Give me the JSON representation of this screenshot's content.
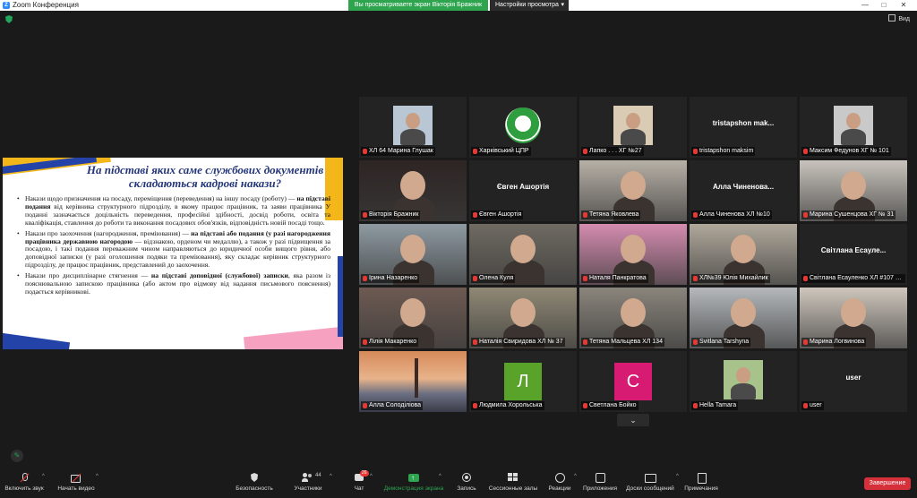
{
  "window": {
    "title": "Zoom Конференция",
    "share_banner": "Вы просматриваете экран Вікторія Бражник",
    "view_settings": "Настройки просмотра",
    "min": "—",
    "max": "□",
    "close": "✕"
  },
  "topbar": {
    "view_label": "Вид"
  },
  "slide": {
    "title": "На підставі яких саме службових документів складаються кадрові накази?",
    "paragraphs": [
      {
        "a": "Накази щодо призначення на посаду, переміщення (переведення) на іншу посаду (роботу) — ",
        "b": "на підставі подання",
        "c": " від керівника структурного підрозділу, в якому працює працівник, та заяви працівника У поданні зазначається доцільність переведення, професійні здібності, досвід роботи, освіта та кваліфікація, ставлення до роботи та виконання посадових обов'язків, відповідність новій посаді тощо."
      },
      {
        "a": "Накази про заохочення (нагородження, преміювання) — ",
        "b": "на підставі або подання (у разі нагородження працівника державною нагородою",
        "c": " — відзнакою, орденом чи медаллю), а також у разі підвищення за посадою, і такі подання переважним чином направляються до юридичної особи вищого рівня, або доповідної записки (у разі оголошення подяки та преміювання), яку складає керівник структурного підрозділу, де працює працівник, представлений до заохочення."
      },
      {
        "a": "Накази про дисциплінарне стягнення — ",
        "b": "на підставі доповідної (службової) записки",
        "c": ", яка разом із пояснювальною запискою працівника (або актом про відмову від надання письмового пояснення) подається керівникові."
      }
    ]
  },
  "participants": [
    {
      "name": "ХЛ 64 Марина Глушак",
      "kind": "photo-small",
      "color": "#b9c6d4"
    },
    {
      "name": "Харківський ЦПР",
      "kind": "logo"
    },
    {
      "name": "Лапко . . . ХГ №27",
      "kind": "photo-small",
      "color": "#d9cbb4"
    },
    {
      "name": "tristapshon maksim",
      "kind": "text",
      "big": "tristapshon mak..."
    },
    {
      "name": "Максим Федунов ХГ № 101",
      "kind": "photo-small",
      "color": "#c9c9c9"
    },
    {
      "name": "Вікторія Бражник",
      "kind": "video",
      "color": "#2e2524",
      "active": true
    },
    {
      "name": "Євген Ашортія",
      "kind": "text",
      "big": "Євген Ашортія"
    },
    {
      "name": "Тетяна Яковлева",
      "kind": "video",
      "color": "#b7b0a6"
    },
    {
      "name": "Алла Чиненова ХЛ №10",
      "kind": "text",
      "big": "Алла Чиненова..."
    },
    {
      "name": "Марина Сушенцова ХГ № 31",
      "kind": "video",
      "color": "#c8c3bc"
    },
    {
      "name": "Ірина Назаренко",
      "kind": "video",
      "color": "#8e9aa2"
    },
    {
      "name": "Олена Куля",
      "kind": "video",
      "color": "#6f6a62"
    },
    {
      "name": "Наталя Панкратова",
      "kind": "video",
      "color": "#d58cb0"
    },
    {
      "name": "ХЛ№39 Юлія Михайлик",
      "kind": "video",
      "color": "#b0a89b"
    },
    {
      "name": "Світлана Есауленко ХЛ #107 Х...",
      "kind": "text",
      "big": "Світлана Есауле..."
    },
    {
      "name": "Лілія Макаренко",
      "kind": "video",
      "color": "#6d5a52"
    },
    {
      "name": "Наталія Свиридова ХЛ № 37",
      "kind": "video",
      "color": "#8f8875"
    },
    {
      "name": "Тетяна Мальцева ХЛ 134",
      "kind": "video",
      "color": "#8a857c"
    },
    {
      "name": "Svitlana Tarshyna",
      "kind": "video",
      "color": "#b5b9bc"
    },
    {
      "name": "Марина Логвинова",
      "kind": "video",
      "color": "#cfc7bd"
    },
    {
      "name": "Алла Солоділіова",
      "kind": "bridge"
    },
    {
      "name": "Людмила Хорольська",
      "kind": "letter",
      "letter": "Л",
      "color": "#5aa32b"
    },
    {
      "name": "Светлана Бойко",
      "kind": "letter",
      "letter": "С",
      "color": "#d81b72"
    },
    {
      "name": "Hella Tamara",
      "kind": "photo-small",
      "color": "#a7c28a"
    },
    {
      "name": "user",
      "kind": "text",
      "big": "user"
    }
  ],
  "toolbar": {
    "mute_label": "Включить звук",
    "video_label": "Начать видео",
    "security_label": "Безопасность",
    "participants_label": "Участники",
    "participants_count": "44",
    "chat_label": "Чат",
    "chat_badge": "26",
    "share_label": "Демонстрация экрана",
    "record_label": "Запись",
    "breakout_label": "Сессионные залы",
    "reactions_label": "Реакции",
    "apps_label": "Приложения",
    "whiteboard_label": "Доски сообщений",
    "notes_label": "Примечания",
    "end_label": "Завершение"
  },
  "colors": {
    "accent_green": "#2ea44f",
    "end_red": "#d6303a",
    "active_outline": "#d4e157",
    "muted_red": "#e53935"
  }
}
